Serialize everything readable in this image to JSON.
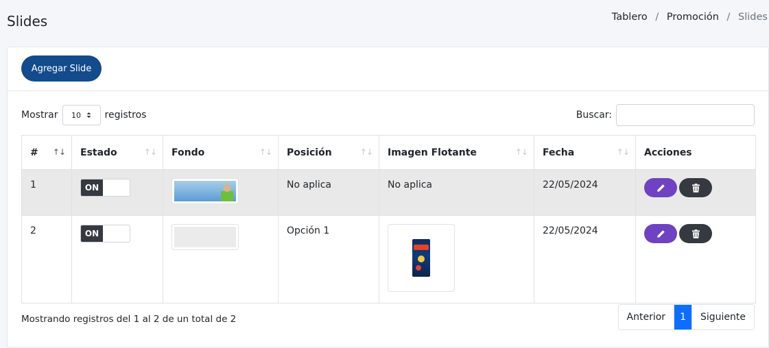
{
  "page": {
    "title": "Slides"
  },
  "breadcrumb": {
    "items": [
      "Tablero",
      "Promoción",
      "Slides"
    ],
    "separator": "/"
  },
  "toolbar": {
    "add_label": "Agregar Slide"
  },
  "table_controls": {
    "show_label": "Mostrar",
    "page_size": "10",
    "records_label": "registros",
    "search_label": "Buscar:"
  },
  "table": {
    "headers": [
      "#",
      "Estado",
      "Fondo",
      "Posición",
      "Imagen Flotante",
      "Fecha",
      "Acciones"
    ],
    "rows": [
      {
        "num": "1",
        "estado": "ON",
        "fondo": "image-thumbnail",
        "posicion": "No aplica",
        "imagen_flotante": "No aplica",
        "fecha": "22/05/2024"
      },
      {
        "num": "2",
        "estado": "ON",
        "fondo": "empty-thumbnail",
        "posicion": "Opción 1",
        "imagen_flotante": "product-image",
        "fecha": "22/05/2024"
      }
    ]
  },
  "footer": {
    "info": "Mostrando registros del 1 al 2 de un total de 2",
    "pagination": {
      "prev": "Anterior",
      "current": "1",
      "next": "Siguiente"
    }
  },
  "icons": {
    "sort": "sort-arrows-icon",
    "edit": "pencil-icon",
    "delete": "trash-icon",
    "select": "select-arrows-icon"
  },
  "colors": {
    "primary": "#134b8c",
    "edit_button": "#6f42c1",
    "delete_button": "#343a40",
    "pagination_active": "#0d6efd",
    "row_highlight": "#e9e9e9"
  }
}
